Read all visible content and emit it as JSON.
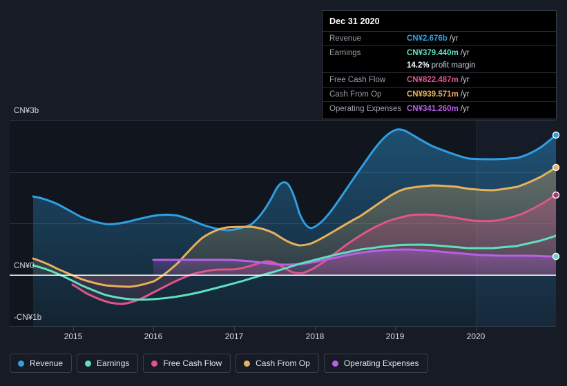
{
  "chart_data": {
    "type": "area",
    "title": "",
    "xlabel": "",
    "ylabel": "",
    "currency": "CN¥",
    "grid": true,
    "legend_position": "bottom",
    "ylim": [
      -1000000000,
      3000000000
    ],
    "y_ticks": [
      {
        "value": 3000000000,
        "label": "CN¥3b"
      },
      {
        "value": 0,
        "label": "CN¥0"
      },
      {
        "value": -1000000000,
        "label": "-CN¥1b"
      }
    ],
    "x_ticks": [
      "2015",
      "2016",
      "2017",
      "2018",
      "2019",
      "2020"
    ],
    "x_range": [
      "2014-06",
      "2021-03"
    ],
    "series": [
      {
        "name": "Revenue",
        "color": "#2f9fe3",
        "fill": true,
        "values": [
          1.52,
          1.45,
          1.33,
          1.2,
          1.11,
          1.09,
          1.13,
          1.21,
          1.26,
          1.22,
          1.14,
          1.07,
          1.13,
          1.22,
          1.6,
          1.18,
          1.26,
          1.55,
          1.98,
          2.45,
          2.72,
          2.69,
          2.55,
          2.47,
          2.46,
          2.52,
          2.68
        ]
      },
      {
        "name": "Earnings",
        "color": "#5fe0c0",
        "fill": false,
        "values": [
          0.06,
          0.02,
          -0.06,
          -0.15,
          -0.24,
          -0.32,
          -0.39,
          -0.44,
          -0.46,
          -0.46,
          -0.43,
          -0.37,
          -0.3,
          -0.22,
          -0.14,
          -0.06,
          0.01,
          0.08,
          0.14,
          0.19,
          0.22,
          0.25,
          0.26,
          0.27,
          0.29,
          0.33,
          0.379
        ]
      },
      {
        "name": "Free Cash Flow",
        "color": "#e0558a",
        "fill": true,
        "values": [
          null,
          null,
          -0.21,
          -0.38,
          -0.52,
          -0.6,
          -0.57,
          -0.48,
          -0.38,
          -0.28,
          -0.19,
          -0.12,
          -0.06,
          -0.01,
          0.05,
          0.09,
          0.07,
          0.03,
          0.16,
          0.38,
          0.56,
          0.63,
          0.61,
          0.55,
          0.55,
          0.66,
          0.822
        ]
      },
      {
        "name": "Cash From Op",
        "color": "#e8b15c",
        "fill": true,
        "values": [
          0.1,
          0.05,
          -0.02,
          -0.09,
          -0.16,
          -0.21,
          -0.24,
          -0.25,
          -0.21,
          -0.1,
          0.12,
          0.34,
          0.46,
          0.48,
          0.48,
          0.4,
          0.24,
          0.16,
          0.18,
          0.34,
          0.58,
          0.72,
          0.74,
          0.72,
          0.7,
          0.78,
          0.939
        ]
      },
      {
        "name": "Operating Expenses",
        "color": "#b95fe8",
        "fill": true,
        "values": [
          null,
          null,
          null,
          null,
          null,
          null,
          0.13,
          0.14,
          0.15,
          0.16,
          0.17,
          0.18,
          0.19,
          0.2,
          0.21,
          0.18,
          0.15,
          0.14,
          0.16,
          0.2,
          0.25,
          0.28,
          0.29,
          0.28,
          0.28,
          0.31,
          0.341
        ]
      }
    ]
  },
  "tooltip": {
    "date": "Dec 31 2020",
    "unit_suffix": "/yr",
    "rows": [
      {
        "label": "Revenue",
        "value": "CN¥2.676b",
        "color": "#2f9fe3",
        "unit": "/yr"
      },
      {
        "label": "Earnings",
        "value": "CN¥379.440m",
        "color": "#5fe0c0",
        "unit": "/yr"
      },
      {
        "label": "Free Cash Flow",
        "value": "CN¥822.487m",
        "color": "#e0558a",
        "unit": "/yr"
      },
      {
        "label": "Cash From Op",
        "value": "CN¥939.571m",
        "color": "#e8b15c",
        "unit": "/yr"
      },
      {
        "label": "Operating Expenses",
        "value": "CN¥341.260m",
        "color": "#b95fe8",
        "unit": "/yr"
      }
    ],
    "profit_margin": {
      "value": "14.2%",
      "label": "profit margin"
    }
  },
  "legend": {
    "items": [
      {
        "label": "Revenue",
        "color": "#2f9fe3"
      },
      {
        "label": "Earnings",
        "color": "#5fe0c0"
      },
      {
        "label": "Free Cash Flow",
        "color": "#e0558a"
      },
      {
        "label": "Cash From Op",
        "color": "#e8b15c"
      },
      {
        "label": "Operating Expenses",
        "color": "#b95fe8"
      }
    ]
  },
  "axis": {
    "y_labels": [
      "CN¥3b",
      "CN¥0",
      "-CN¥1b"
    ],
    "x_labels": [
      "2015",
      "2016",
      "2017",
      "2018",
      "2019",
      "2020"
    ]
  },
  "colors": {
    "background": "#161b25",
    "plot_background": "#11151d",
    "grid": "#2e3340",
    "zero_line": "#ffffff",
    "axis_text": "#d6dae2"
  }
}
